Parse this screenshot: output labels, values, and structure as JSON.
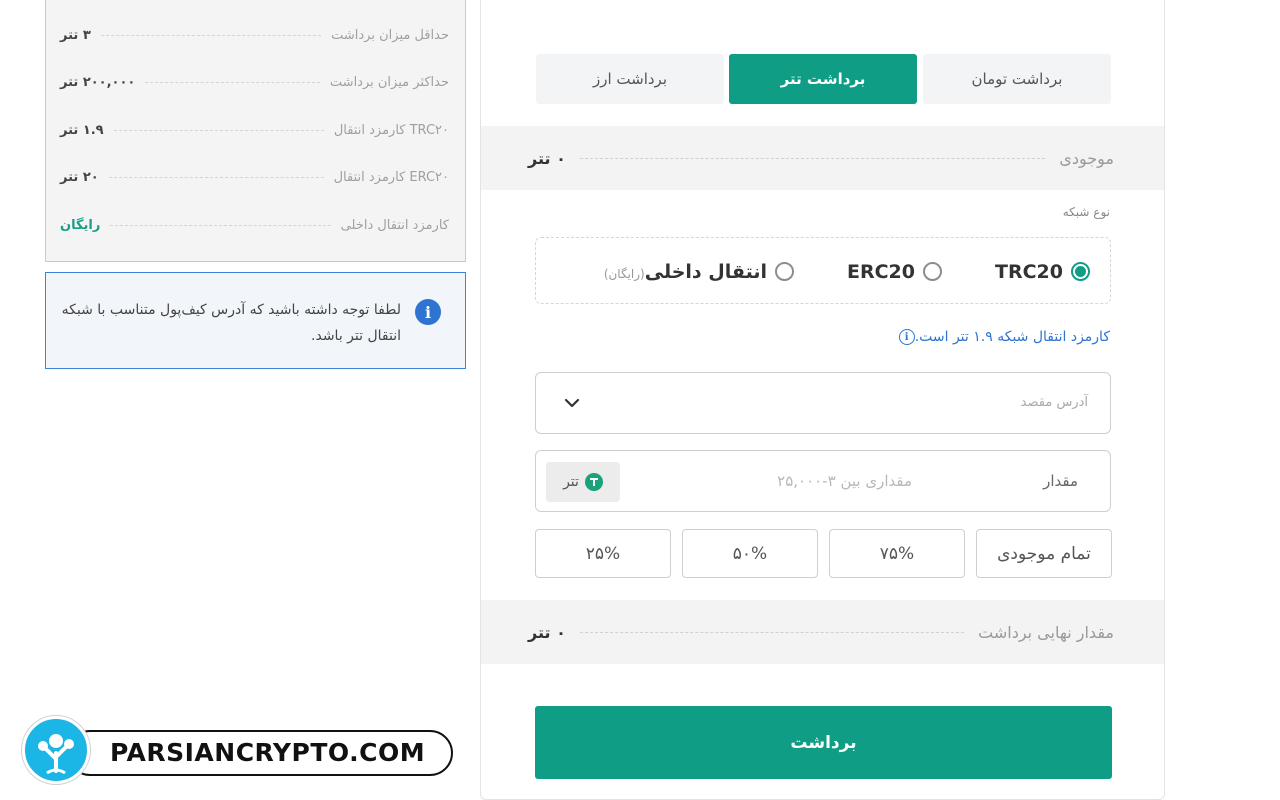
{
  "limits": [
    {
      "label": "حداقل میزان برداشت",
      "value": "۳ تتر",
      "color": "#444444"
    },
    {
      "label": "حداکثر میزان برداشت",
      "value": "۲۰۰,۰۰۰ تتر",
      "color": "#444444"
    },
    {
      "label": "کارمزد انتقال  TRC۲۰",
      "value": "۱.۹ تتر",
      "color": "#444444"
    },
    {
      "label": "کارمزد انتقال ERC۲۰",
      "value": "۲۰ تتر",
      "color": "#444444"
    },
    {
      "label": "کارمزد انتقال داخلی",
      "value": "رایگان",
      "color": "#16a085"
    }
  ],
  "notice": {
    "icon": "info-icon",
    "text": "لطفا توجه داشته باشید که آدرس کیف‌پول متناسب با شبکه انتقال تتر باشد."
  },
  "tabs": [
    {
      "label": "برداشت تومان",
      "active": false
    },
    {
      "label": "برداشت تتر",
      "active": true
    },
    {
      "label": "برداشت ارز",
      "active": false
    }
  ],
  "balance": {
    "label": "موجودی",
    "value": "۰ تتر"
  },
  "network": {
    "label": "نوع شبکه",
    "options": [
      {
        "label": "TRC20",
        "sub": "",
        "checked": true
      },
      {
        "label": "ERC20",
        "sub": "",
        "checked": false
      },
      {
        "label": "انتقال داخلی",
        "sub": "(رایگان)",
        "checked": false
      }
    ]
  },
  "fee_note": "کارمزد انتقال شبکه ۱.۹ تتر است.",
  "address": {
    "placeholder": "آدرس مقصد",
    "icon": "chevron-down-icon"
  },
  "amount": {
    "label": "مقدار",
    "placeholder": "مقداری بین ۳-۲۵,۰۰۰",
    "currency": "تتر",
    "currency_icon": "tether-icon"
  },
  "percent_buttons": [
    "تمام موجودی",
    "۷۵%",
    "۵۰%",
    "۲۵%"
  ],
  "final_amount": {
    "label": "مقدار نهایی برداشت",
    "value": "۰ تتر"
  },
  "submit_label": "برداشت",
  "watermark": {
    "text": "PARSIANCRYPTO.COM"
  },
  "colors": {
    "accent": "#0f9e85",
    "info": "#2f74d0",
    "free": "#16a085"
  }
}
